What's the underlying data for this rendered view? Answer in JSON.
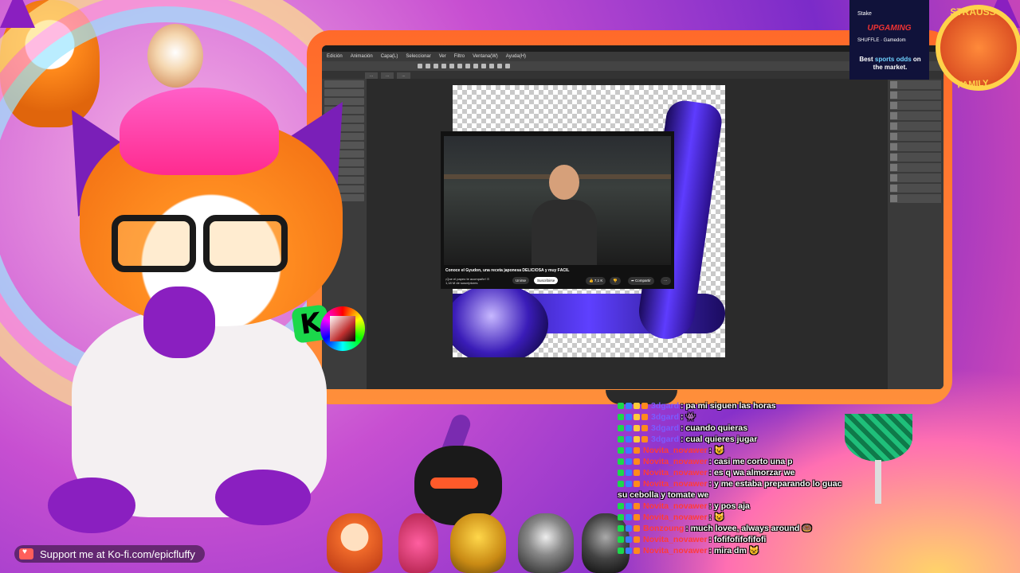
{
  "app": {
    "menu": [
      "Edición",
      "Animación",
      "Capa(L)",
      "Seleccionar",
      "Ver",
      "Filtro",
      "Ventana(W)",
      "Ayuda(H)"
    ],
    "tabs": [
      "...",
      "...",
      "..."
    ]
  },
  "video": {
    "title": "Conoce el Gyudon, una receta japonesa DELICIOSA y muy FÁCIL",
    "channel": "¡Que el papeo te acompañe! ⊙",
    "subs": "1,18 M de suscriptores",
    "join_label": "Unirse",
    "subscribe_label": "Suscribirse",
    "likes": "7,1 K",
    "share_label": "Compartir"
  },
  "ad": {
    "brand": "Stake",
    "logo": "UPGAMING",
    "partner": "SHUFFLE · Gamedom",
    "headline_pre": "Best ",
    "headline_highlight": "sports odds",
    "headline_post": " on the market."
  },
  "team_badge": {
    "top": "STRAUSS",
    "bottom": "FAMILY"
  },
  "kbadge": "K",
  "chat": {
    "messages": [
      {
        "user": "3dgard",
        "text": ": pa mi siguen las horas",
        "color": "#7b5bff",
        "badges": [
          "#1bd84b",
          "#3a7bff",
          "#ffcb3a",
          "#ff8a1c"
        ]
      },
      {
        "user": "3dgard",
        "text": ": 👾",
        "color": "#7b5bff",
        "badges": [
          "#1bd84b",
          "#3a7bff",
          "#ffcb3a",
          "#ff8a1c"
        ]
      },
      {
        "user": "3dgard",
        "text": ": cuando quieras",
        "color": "#7b5bff",
        "badges": [
          "#1bd84b",
          "#3a7bff",
          "#ffcb3a",
          "#ff8a1c"
        ]
      },
      {
        "user": "3dgard",
        "text": ": cual quieres jugar",
        "color": "#7b5bff",
        "badges": [
          "#1bd84b",
          "#3a7bff",
          "#ffcb3a",
          "#ff8a1c"
        ]
      },
      {
        "user": "Novita_novawer",
        "text": ": 😺",
        "color": "#ff3a3a",
        "badges": [
          "#1bd84b",
          "#3a7bff",
          "#ff8a1c"
        ]
      },
      {
        "user": "Novita_novawer",
        "text": ": casi me corto una p",
        "color": "#ff3a3a",
        "badges": [
          "#1bd84b",
          "#3a7bff",
          "#ff8a1c"
        ]
      },
      {
        "user": "Novita_novawer",
        "text": ": es q wa almorzar we",
        "color": "#ff3a3a",
        "badges": [
          "#1bd84b",
          "#3a7bff",
          "#ff8a1c"
        ]
      },
      {
        "user": "Novita_novawer",
        "text": ": y me estaba preparando lo guac",
        "color": "#ff3a3a",
        "badges": [
          "#1bd84b",
          "#3a7bff",
          "#ff8a1c"
        ]
      }
    ],
    "continuation": "su cebolla y tomate we",
    "messages2": [
      {
        "user": "Novita_novawer",
        "text": ": y pos aja",
        "color": "#ff3a3a",
        "badges": [
          "#1bd84b",
          "#3a7bff",
          "#ff8a1c"
        ]
      },
      {
        "user": "Novita_novawer",
        "text": ": 😺",
        "color": "#ff3a3a",
        "badges": [
          "#1bd84b",
          "#3a7bff",
          "#ff8a1c"
        ]
      },
      {
        "user": "Bonzoung",
        "text": ": much lovee, always around 🍩",
        "color": "#ff3a3a",
        "badges": [
          "#1bd84b",
          "#3a7bff",
          "#ff8a1c"
        ]
      },
      {
        "user": "Novita_novawer",
        "text": ": fofifofifofifofi",
        "color": "#ff3a3a",
        "badges": [
          "#1bd84b",
          "#3a7bff",
          "#ff8a1c"
        ]
      },
      {
        "user": "Novita_novawer",
        "text": ": mira dm 😺",
        "color": "#ff3a3a",
        "badges": [
          "#1bd84b",
          "#3a7bff",
          "#ff8a1c"
        ]
      }
    ]
  },
  "kofi": {
    "text": "Support me at Ko-fi.com/epicfluffy"
  }
}
